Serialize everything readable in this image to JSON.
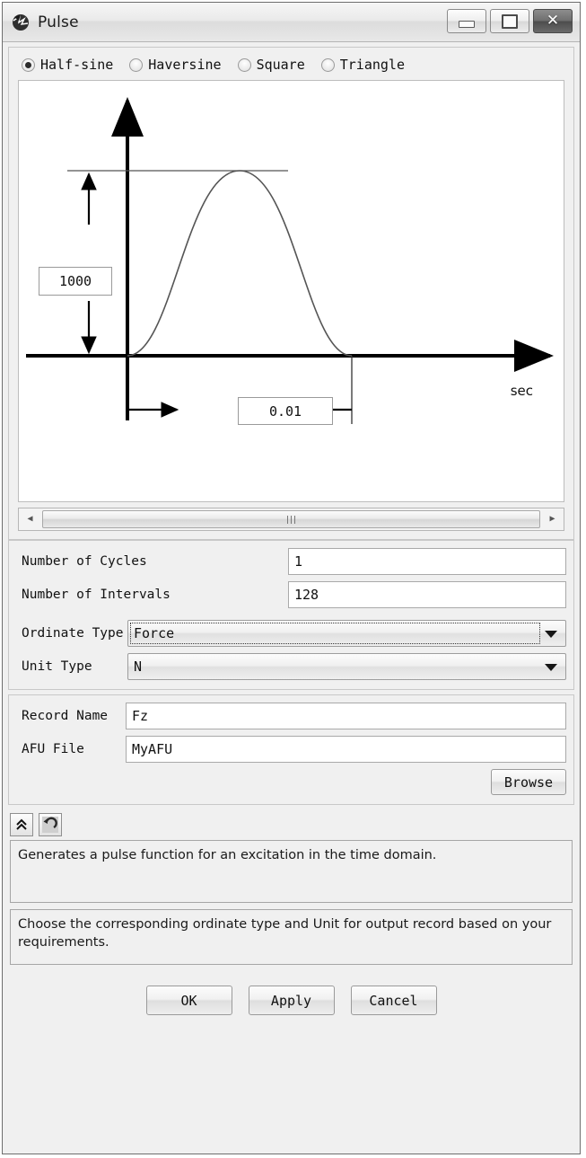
{
  "window": {
    "title": "Pulse",
    "icon": "pulse-app-icon",
    "controls": {
      "minimize": "minimize-icon",
      "maximize": "maximize-icon",
      "close": "✕"
    }
  },
  "pulse_shape": {
    "options": [
      {
        "label": "Half-sine",
        "selected": true
      },
      {
        "label": "Haversine",
        "selected": false
      },
      {
        "label": "Square",
        "selected": false
      },
      {
        "label": "Triangle",
        "selected": false
      }
    ]
  },
  "chart_data": {
    "type": "line",
    "title": "",
    "xlabel": "sec",
    "ylabel": "",
    "amplitude_value": "1000",
    "duration_value": "0.01",
    "x": [
      0,
      0.001,
      0.002,
      0.003,
      0.004,
      0.005,
      0.006,
      0.007,
      0.008,
      0.009,
      0.01
    ],
    "y": [
      0,
      309,
      588,
      809,
      951,
      1000,
      951,
      809,
      588,
      309,
      0
    ],
    "xlim": [
      -0.0035,
      0.0155
    ],
    "ylim": [
      -250,
      1450
    ],
    "grid": false,
    "legend": false,
    "annotations": [
      {
        "name": "amplitude-dimension",
        "value": "1000"
      },
      {
        "name": "duration-dimension",
        "value": "0.01"
      },
      {
        "name": "x-axis-unit",
        "value": "sec"
      }
    ]
  },
  "scrollbar": {
    "left_arrow": "◀",
    "right_arrow": "▶",
    "grip": "grip-lines"
  },
  "parameters": {
    "cycles": {
      "label": "Number of Cycles",
      "value": "1"
    },
    "intervals": {
      "label": "Number of Intervals",
      "value": "128"
    },
    "ordinate_type": {
      "label": "Ordinate Type",
      "value": "Force"
    },
    "unit_type": {
      "label": "Unit Type",
      "value": "N"
    }
  },
  "output": {
    "record_name": {
      "label": "Record Name",
      "value": "Fz"
    },
    "afu_file": {
      "label": "AFU File",
      "value": "MyAFU"
    },
    "browse_label": "Browse"
  },
  "toolbar": {
    "collapse_icon": "chevron-double-up-icon",
    "reset_icon": "reset-arrow-icon"
  },
  "help": {
    "description": "Generates a pulse function for an excitation in the time domain.",
    "hint": "Choose the corresponding ordinate type and Unit for output record based on your requirements."
  },
  "footer": {
    "ok": "OK",
    "apply": "Apply",
    "cancel": "Cancel"
  }
}
